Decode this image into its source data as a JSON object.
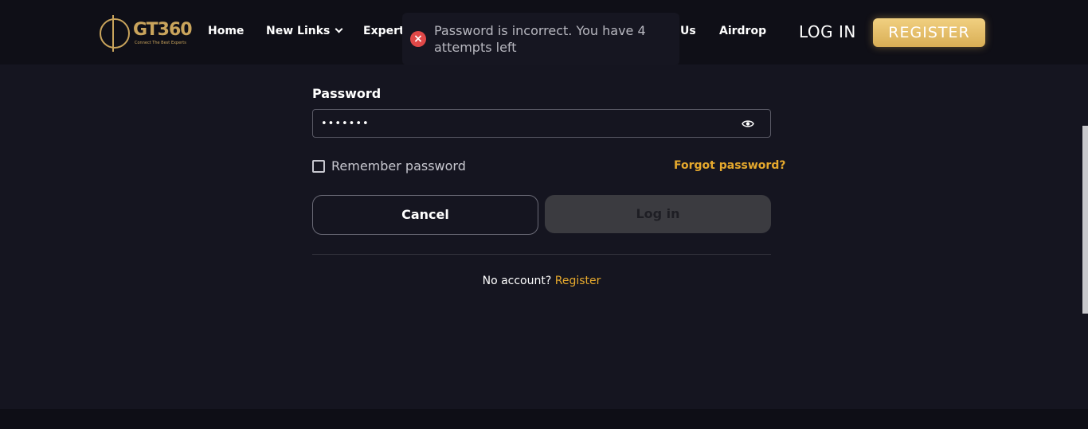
{
  "brand": {
    "logo_text": "GT360",
    "tagline": "Connect The Best Experts"
  },
  "nav": {
    "items": [
      {
        "label": "Home"
      },
      {
        "label": "New Links"
      },
      {
        "label": "Expert"
      },
      {
        "label": "Us"
      },
      {
        "label": "Airdrop"
      }
    ],
    "login_label": "LOG IN",
    "register_label": "REGISTER"
  },
  "toast": {
    "message": "Password is incorrect. You have 4 attempts left",
    "icon": "error-x-icon",
    "color": "#e04848"
  },
  "form": {
    "password_label": "Password",
    "password_value": "•••••••",
    "remember_label": "Remember password",
    "remember_checked": false,
    "forgot_label": "Forgot password?",
    "cancel_label": "Cancel",
    "login_label": "Log in",
    "no_account_text": "No account?",
    "register_link": "Register"
  },
  "colors": {
    "accent": "#e6a92d",
    "register_button": "#e0b964",
    "background": "#151520"
  }
}
